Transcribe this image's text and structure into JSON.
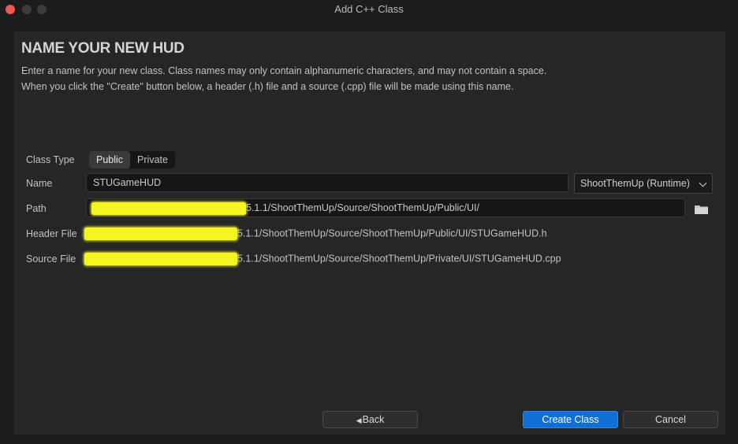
{
  "window": {
    "title": "Add C++ Class"
  },
  "page": {
    "heading": "NAME YOUR NEW HUD",
    "description_line1": "Enter a name for your new class. Class names may only contain alphanumeric characters, and may not contain a space.",
    "description_line2": "When you click the \"Create\" button below, a header (.h) file and a source (.cpp) file will be made using this name."
  },
  "form": {
    "class_type": {
      "label": "Class Type",
      "options": [
        "Public",
        "Private"
      ],
      "selected": "Public"
    },
    "name": {
      "label": "Name",
      "value": "STUGameHUD",
      "module": "ShootThemUp (Runtime)"
    },
    "path": {
      "label": "Path",
      "value": "5.1.1/ShootThemUp/Source/ShootThemUp/Public/UI/"
    },
    "header_file": {
      "label": "Header File",
      "value": "5.1.1/ShootThemUp/Source/ShootThemUp/Public/UI/STUGameHUD.h"
    },
    "source_file": {
      "label": "Source File",
      "value": "5.1.1/ShootThemUp/Source/ShootThemUp/Private/UI/STUGameHUD.cpp"
    }
  },
  "buttons": {
    "back": "Back",
    "create": "Create Class",
    "cancel": "Cancel"
  },
  "icons": {
    "folder": "folder-icon",
    "back": "chevron-left-icon",
    "dropdown": "chevron-down-icon"
  },
  "colors": {
    "accent": "#0e6fd6",
    "redaction": "#f5f523"
  }
}
